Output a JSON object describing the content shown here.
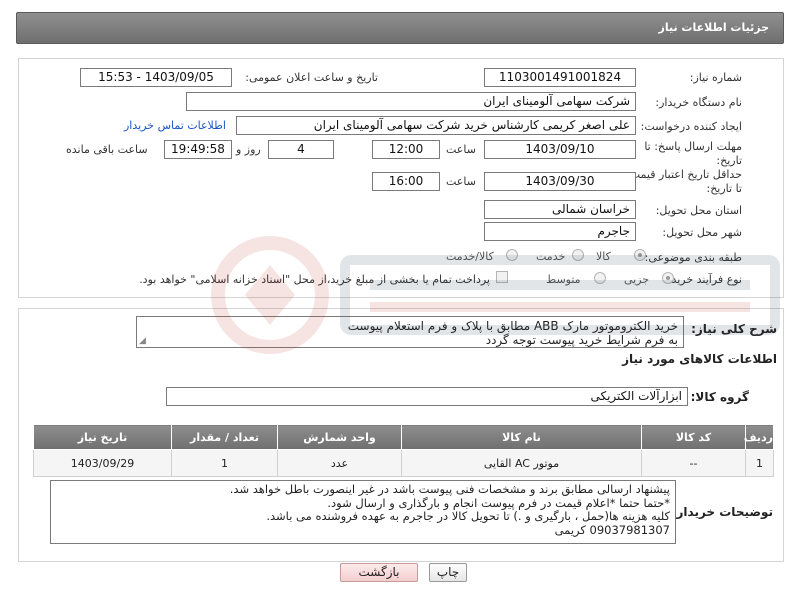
{
  "header": {
    "title": "جزئیات اطلاعات نیاز"
  },
  "form": {
    "need_number_label": "شماره نیاز:",
    "need_number": "1103001491001824",
    "announce_label": "تاریخ و ساعت اعلان عمومی:",
    "announce_value": "1403/09/05 - 15:53",
    "buyer_org_label": "نام دستگاه خریدار:",
    "buyer_org": "شرکت سهامی آلومینای ایران",
    "creator_label": "ایجاد کننده درخواست:",
    "creator": "علی اصغر کریمی کارشناس خرید شرکت سهامی آلومینای ایران",
    "contact_link": "اطلاعات تماس خریدار",
    "reply_deadline_label": "مهلت ارسال پاسخ: تا تاریخ:",
    "reply_date": "1403/09/10",
    "time_label": "ساعت",
    "reply_time": "12:00",
    "days_value": "4",
    "days_label": "روز و",
    "remaining_time": "19:49:58",
    "remaining_label": "ساعت باقی مانده",
    "price_validity_label": "حداقل تاریخ اعتبار قیمت: تا تاریخ:",
    "price_date": "1403/09/30",
    "price_time": "16:00",
    "province_label": "استان محل تحویل:",
    "province": "خراسان شمالی",
    "city_label": "شهر محل تحویل:",
    "city": "جاجرم",
    "category_label": "طبقه بندی موضوعی:",
    "category_options": [
      "کالا",
      "خدمت",
      "کالا/خدمت"
    ],
    "purchase_type_label": "نوع فرآیند خرید :",
    "purchase_options": [
      "جزیی",
      "متوسط"
    ],
    "payment_note": "پرداخت تمام یا بخشی از مبلغ خرید،از محل \"اسناد خزانه اسلامی\" خواهد بود."
  },
  "details": {
    "desc_label": "شرح کلی نیاز:",
    "desc_text": "خرید الکتروموتور مارک ABB مطابق با پلاک و فرم استعلام پیوست\nبه فرم شرایط خرید پیوست توجه گردد",
    "goods_info_title": "اطلاعات کالاهای مورد نیاز",
    "goods_group_label": "گروه کالا:",
    "goods_group": "ابزارآلات الکتریکی"
  },
  "table": {
    "headers": [
      "ردیف",
      "کد کالا",
      "نام کالا",
      "واحد شمارش",
      "تعداد / مقدار",
      "تاریخ نیاز"
    ],
    "rows": [
      [
        "1",
        "--",
        "موتور AC القایی",
        "عدد",
        "1",
        "1403/09/29"
      ]
    ]
  },
  "buyer_notes": {
    "label": "توضیحات خریدار:",
    "text": "پیشنهاد ارسالی مطابق برند و مشخصات فنی پیوست باشد در غیر اینصورت باطل خواهد شد.\n*حتما حتما *اعلام قیمت در فرم پیوست انجام و بارگذاری و ارسال شود.\nکلیه هزینه ها(حمل ، بارگیری و .) تا تحویل کالا در جاجرم به عهده فروشنده می باشد.\n09037981307 کریمی"
  },
  "buttons": {
    "print": "چاپ",
    "back": "بازگشت"
  },
  "colors": {
    "header_bg": "#7d7d7d",
    "link": "#1a56c4",
    "back_button": "#f3cfcf"
  }
}
